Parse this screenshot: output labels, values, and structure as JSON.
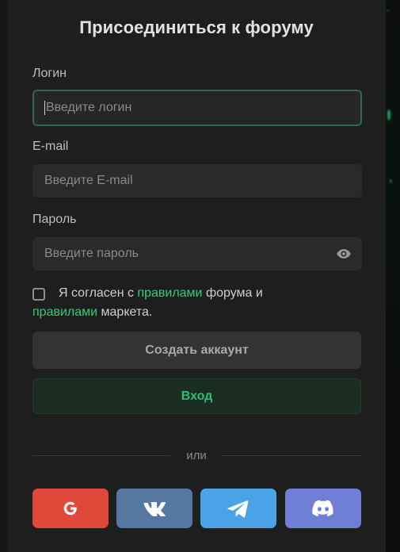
{
  "form": {
    "title": "Присоединиться к форуму",
    "login": {
      "label": "Логин",
      "placeholder": "Введите логин"
    },
    "email": {
      "label": "E-mail",
      "placeholder": "Введите E-mail"
    },
    "password": {
      "label": "Пароль",
      "placeholder": "Введите пароль"
    },
    "agreement": {
      "checked": false,
      "text_1": "Я согласен с ",
      "link_1": "правилами",
      "text_2": " форума и",
      "link_2": "правилами",
      "text_3": " маркета."
    },
    "create_button": "Создать аккаунт",
    "login_button": "Вход",
    "divider_text": "или"
  },
  "social": [
    {
      "name": "google",
      "icon": "google-icon",
      "color": "#e0493a"
    },
    {
      "name": "vk",
      "icon": "vk-icon",
      "color": "#56779f"
    },
    {
      "name": "telegram",
      "icon": "telegram-icon",
      "color": "#4aa3e6"
    },
    {
      "name": "discord",
      "icon": "discord-icon",
      "color": "#6f7fd6"
    }
  ],
  "colors": {
    "accent": "#2fcf79",
    "panel": "#1e1e1e",
    "input": "#2a2a2a"
  }
}
